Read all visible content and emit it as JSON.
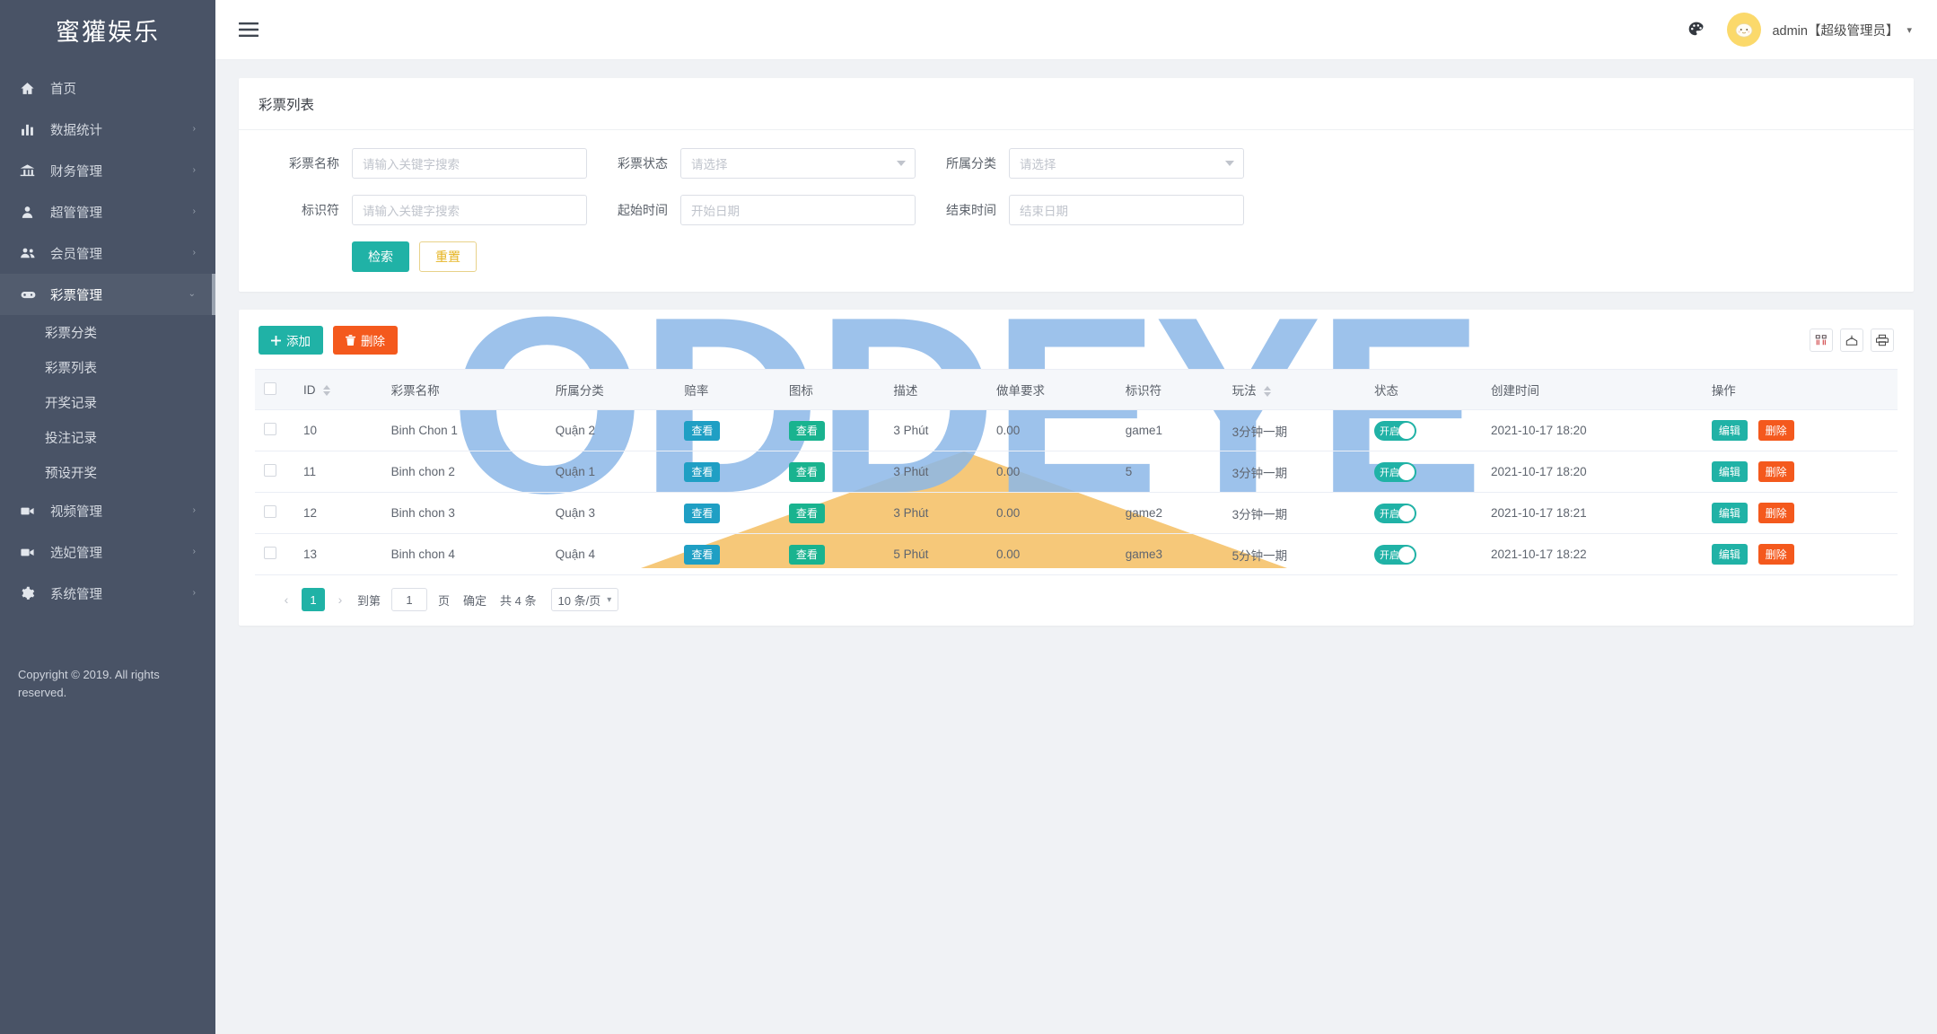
{
  "brand": {
    "title": "蜜獾娱乐"
  },
  "sidebar": {
    "items": [
      {
        "label": "首页",
        "icon": "home-icon",
        "arrow": ""
      },
      {
        "label": "数据统计",
        "icon": "chart-bar-icon",
        "arrow": "›"
      },
      {
        "label": "财务管理",
        "icon": "bank-icon",
        "arrow": "›"
      },
      {
        "label": "超管管理",
        "icon": "user-icon",
        "arrow": "›"
      },
      {
        "label": "会员管理",
        "icon": "users-icon",
        "arrow": "›"
      },
      {
        "label": "彩票管理",
        "icon": "gamepad-icon",
        "arrow": "⌄",
        "active": true
      }
    ],
    "sub_items": [
      {
        "label": "彩票分类"
      },
      {
        "label": "彩票列表"
      },
      {
        "label": "开奖记录"
      },
      {
        "label": "投注记录"
      },
      {
        "label": "预设开奖"
      }
    ],
    "items_after": [
      {
        "label": "视频管理",
        "icon": "video-icon",
        "arrow": "›"
      },
      {
        "label": "选妃管理",
        "icon": "video-icon",
        "arrow": "›"
      },
      {
        "label": "系统管理",
        "icon": "gear-icon",
        "arrow": "›"
      }
    ],
    "copyright": "Copyright © 2019. All rights reserved."
  },
  "topbar": {
    "menu_toggle": "hamburger-icon",
    "theme_icon": "palette-icon",
    "user": "admin【超级管理员】",
    "caret": "▾"
  },
  "search_card": {
    "title": "彩票列表",
    "fields": [
      {
        "label": "彩票名称",
        "placeholder": "请输入关键字搜索",
        "type": "input",
        "value": ""
      },
      {
        "label": "彩票状态",
        "placeholder": "请选择",
        "type": "select",
        "value": ""
      },
      {
        "label": "所属分类",
        "placeholder": "请选择",
        "type": "select",
        "value": ""
      },
      {
        "label": "标识符",
        "placeholder": "请输入关键字搜索",
        "type": "input",
        "value": ""
      },
      {
        "label": "起始时间",
        "placeholder": "开始日期",
        "type": "date",
        "value": ""
      },
      {
        "label": "结束时间",
        "placeholder": "结束日期",
        "type": "date",
        "value": ""
      }
    ],
    "search_button": "检索",
    "reset_button": "重置"
  },
  "table_card": {
    "add_button": "添加",
    "delete_button": "删除",
    "tool_icons": [
      "columns-icon",
      "export-icon",
      "print-icon"
    ],
    "columns": [
      {
        "key": "check",
        "label": ""
      },
      {
        "key": "id",
        "label": "ID",
        "sortable": true
      },
      {
        "key": "name",
        "label": "彩票名称"
      },
      {
        "key": "category",
        "label": "所属分类"
      },
      {
        "key": "odds",
        "label": "赔率"
      },
      {
        "key": "icon",
        "label": "图标"
      },
      {
        "key": "desc",
        "label": "描述"
      },
      {
        "key": "require",
        "label": "做单要求"
      },
      {
        "key": "ident",
        "label": "标识符"
      },
      {
        "key": "play",
        "label": "玩法",
        "sortable": true
      },
      {
        "key": "status",
        "label": "状态"
      },
      {
        "key": "created",
        "label": "创建时间"
      },
      {
        "key": "actions",
        "label": "操作"
      }
    ],
    "rows": [
      {
        "id": "10",
        "name": "Binh Chon 1",
        "category": "Quận 2",
        "odds": "查看",
        "icon": "查看",
        "desc": "3 Phút",
        "require": "0.00",
        "ident": "game1",
        "play": "3分钟一期",
        "status": "开启",
        "created": "2021-10-17 18:20",
        "edit": "编辑",
        "delete": "删除"
      },
      {
        "id": "11",
        "name": "Binh chon 2",
        "category": "Quận 1",
        "odds": "查看",
        "icon": "查看",
        "desc": "3 Phút",
        "require": "0.00",
        "ident": "5",
        "play": "3分钟一期",
        "status": "开启",
        "created": "2021-10-17 18:20",
        "edit": "编辑",
        "delete": "删除"
      },
      {
        "id": "12",
        "name": "Binh chon 3",
        "category": "Quận 3",
        "odds": "查看",
        "icon": "查看",
        "desc": "3 Phút",
        "require": "0.00",
        "ident": "game2",
        "play": "3分钟一期",
        "status": "开启",
        "created": "2021-10-17 18:21",
        "edit": "编辑",
        "delete": "删除"
      },
      {
        "id": "13",
        "name": "Binh chon 4",
        "category": "Quận 4",
        "odds": "查看",
        "icon": "查看",
        "desc": "5 Phút",
        "require": "0.00",
        "ident": "game3",
        "play": "5分钟一期",
        "status": "开启",
        "created": "2021-10-17 18:22",
        "edit": "编辑",
        "delete": "删除"
      }
    ],
    "pagination": {
      "prev": "‹",
      "current_page": "1",
      "next": "›",
      "goto_label": "到第",
      "goto_value": "1",
      "page_unit": "页",
      "confirm": "确定",
      "total": "共 4 条",
      "page_size": "10 条/页",
      "page_size_caret": "▾"
    }
  },
  "watermark": {
    "text": "ODDEYE",
    "color": "#8cb8e8",
    "accent": "#f6c572"
  },
  "colors": {
    "sidebar_bg": "#495366",
    "primary": "#20b2a6",
    "danger": "#f4591d",
    "warning": "#e6b422",
    "badge_blue": "#1f9fc4",
    "badge_green": "#19b38f"
  }
}
